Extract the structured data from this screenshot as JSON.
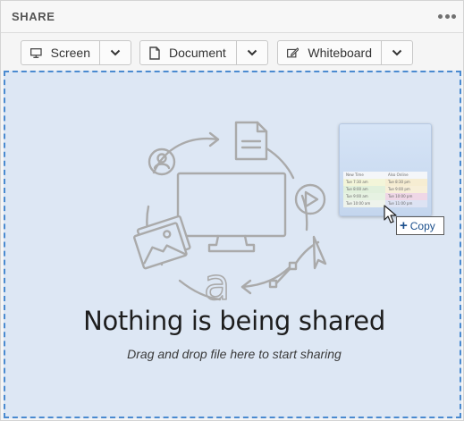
{
  "header": {
    "title": "SHARE",
    "more_icon": "more-horizontal-icon"
  },
  "toolbar": {
    "screen": {
      "label": "Screen",
      "icon": "monitor-icon"
    },
    "document": {
      "label": "Document",
      "icon": "document-icon"
    },
    "whiteboard": {
      "label": "Whiteboard",
      "icon": "whiteboard-pen-icon"
    }
  },
  "dropzone": {
    "title": "Nothing is being shared",
    "subtitle": "Drag and drop file here to start sharing",
    "copy_tooltip": "Copy",
    "thumbnail": {
      "headers": [
        "New  Time",
        "Also Online"
      ],
      "rows": [
        [
          "Tue 7:30 am",
          "Tue 8:30 pm"
        ],
        [
          "Tue 8:00 am",
          "Tue 9:00 pm"
        ],
        [
          "Tue 9:00 am",
          "Tue 10:00 pm"
        ],
        [
          "Tue 10:00 am",
          "Tue 11:00 pm"
        ]
      ]
    }
  },
  "colors": {
    "dropzone_bg": "#dde7f4",
    "dropzone_border": "#4a8ad0",
    "illustration_stroke": "#a9a9a9"
  }
}
